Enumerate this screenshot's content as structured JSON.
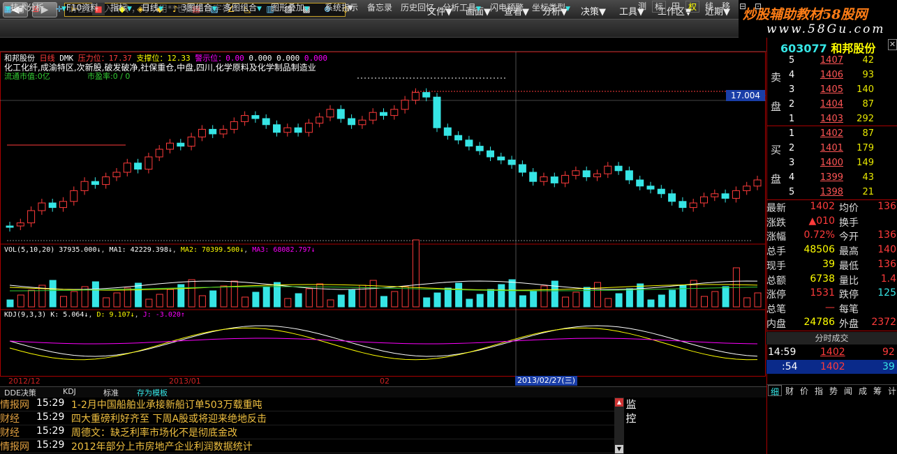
{
  "topbar": {
    "back": "◀",
    "fwd": "▶",
    "cmd_placeholder": "请在此输入命令，可以用**也配任意字符",
    "menus": [
      "文件▼",
      "画面▼",
      "查看▼",
      "分析▼",
      "决策▼",
      "工具▼",
      "工作区▼",
      "近期▼"
    ]
  },
  "logo": {
    "line1": "炒股辅助教材58股网",
    "line2": "www.58Gu.com"
  },
  "menubar2": {
    "items": [
      "技术分析",
      "F10资料",
      "指标",
      "日线",
      "3图组合",
      "多图组合",
      "图形叠加",
      "系统指示",
      "备忘录",
      "历史回忆",
      "分析工具",
      "闪电预警",
      "坐标类型"
    ],
    "right": [
      "测",
      "标",
      "田",
      "权",
      "线",
      "移",
      "⊟",
      "⊡"
    ]
  },
  "info": {
    "name": "和邦股份",
    "period": "日线",
    "dmk": "DMK",
    "p1": "压力位：17.37",
    "p2": "支撑位：12.33",
    "p3": "警示位：0.00",
    "p4": "0.000",
    "p5": "0.000",
    "p6": "0.000",
    "sector": "化工化纤,成渝特区,次新股,破发破净,社保重仓,中盘,四川,化学原料及化学制品制造业",
    "mktval": "流通市值:0亿",
    "pe": "市盈率:0 / 0"
  },
  "chart": {
    "resistance": "17.37",
    "support": "12.33",
    "price_tag": "17.004"
  },
  "vol": {
    "t": "VOL(5,10,20)",
    "v": "37935.000↓",
    "ma1": "MA1: 42229.398↓",
    "ma2": "MA2: 70399.500↓",
    "ma3": "MA3: 68082.797↓"
  },
  "kdj": {
    "t": "KDJ(9,3,3)",
    "k": "K: 5.064↓",
    "d": "D: 9.107↓",
    "j": "J: -3.020↑"
  },
  "dates": {
    "d1": "2012/12",
    "d2": "2013/01",
    "d3": "02",
    "cur": "2013/02/27(三)"
  },
  "tabs": [
    "DDE决策",
    "KDJ",
    "标准",
    "存为模板"
  ],
  "news": [
    {
      "src": "情报网",
      "time": "15:29",
      "title": "1-2月中国船舶业承接新船订单503万载重吨"
    },
    {
      "src": "财经",
      "time": "15:29",
      "title": "四大重磅利好齐至 下周A股或将迎来绝地反击"
    },
    {
      "src": "财经",
      "time": "15:29",
      "title": "周德文：缺乏利率市场化不是彻底金改"
    },
    {
      "src": "情报网",
      "time": "15:29",
      "title": "2012年部分上市房地产企业利润数据统计"
    }
  ],
  "monitor": "监控",
  "quote": {
    "code": "603077",
    "name": "和邦股份",
    "sell": [
      {
        "l": "5",
        "p": "1407",
        "q": "42"
      },
      {
        "l": "4",
        "p": "1406",
        "q": "93"
      },
      {
        "l": "3",
        "p": "1405",
        "q": "140"
      },
      {
        "l": "2",
        "p": "1404",
        "q": "87"
      },
      {
        "l": "1",
        "p": "1403",
        "q": "292"
      }
    ],
    "buy": [
      {
        "l": "1",
        "p": "1402",
        "q": "87"
      },
      {
        "l": "2",
        "p": "1401",
        "q": "179"
      },
      {
        "l": "3",
        "p": "1400",
        "q": "149"
      },
      {
        "l": "4",
        "p": "1399",
        "q": "43"
      },
      {
        "l": "5",
        "p": "1398",
        "q": "21"
      }
    ],
    "sell_label": [
      "卖",
      "盘"
    ],
    "buy_label": [
      "买",
      "盘"
    ],
    "stats": [
      {
        "a": "最新",
        "av": "1402",
        "b": "均价",
        "bv": "136"
      },
      {
        "a": "涨跌",
        "av": "▲010",
        "b": "换手",
        "bv": ""
      },
      {
        "a": "涨幅",
        "av": "0.72%",
        "b": "今开",
        "bv": "136"
      },
      {
        "a": "总手",
        "av": "48506",
        "b": "最高",
        "bv": "140"
      },
      {
        "a": "现手",
        "av": "39",
        "b": "最低",
        "bv": "136"
      },
      {
        "a": "总额",
        "av": "6738",
        "b": "量比",
        "bv": "1.4"
      },
      {
        "a": "涨停",
        "av": "1531",
        "b": "跌停",
        "bv": "125"
      },
      {
        "a": "总笔",
        "av": "—",
        "b": "每笔",
        "bv": ""
      },
      {
        "a": "内盘",
        "av": "24786",
        "b": "外盘",
        "bv": "2372"
      }
    ],
    "trade_head": "分时成交",
    "trades": [
      {
        "t": "14:59",
        "p": "1402",
        "q": "92"
      },
      {
        "t": ":54",
        "p": "1402",
        "q": "39"
      }
    ],
    "btabs": [
      "细",
      "财",
      "价",
      "指",
      "势",
      "闻",
      "成",
      "筹",
      "计"
    ]
  },
  "colors": {
    "up": "#ff3b3b",
    "down": "#36e5e5",
    "ma1": "#ffffff",
    "ma2": "#ffff00",
    "ma3": "#ff00ff"
  }
}
